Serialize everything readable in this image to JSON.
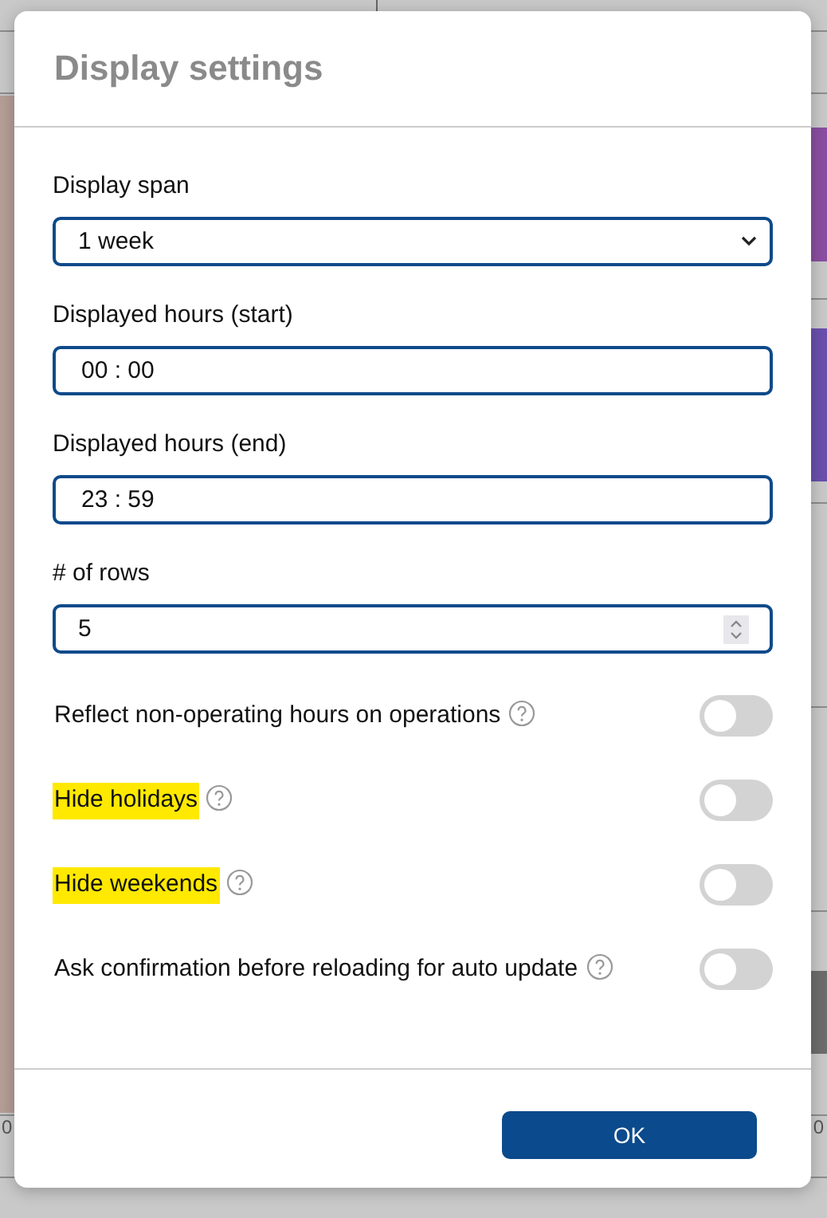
{
  "background": {
    "left_time": "0",
    "right_time": "0"
  },
  "dialog": {
    "title": "Display settings",
    "fields": [
      {
        "kind": "select",
        "label": "Display span",
        "value": "1 week"
      },
      {
        "kind": "time",
        "label": "Displayed hours (start)",
        "value": "00 : 00"
      },
      {
        "kind": "time",
        "label": "Displayed hours (end)",
        "value": "23 : 59"
      },
      {
        "kind": "number",
        "label": "# of rows",
        "value": "5"
      }
    ],
    "toggles": [
      {
        "label": "Reflect non-operating hours on operations",
        "on": false,
        "highlighted": false
      },
      {
        "label": "Hide holidays",
        "on": false,
        "highlighted": true
      },
      {
        "label": "Hide weekends",
        "on": false,
        "highlighted": true
      },
      {
        "label": "Ask confirmation before reloading for auto update",
        "on": false,
        "highlighted": false
      }
    ],
    "buttons": [
      "OK"
    ]
  }
}
